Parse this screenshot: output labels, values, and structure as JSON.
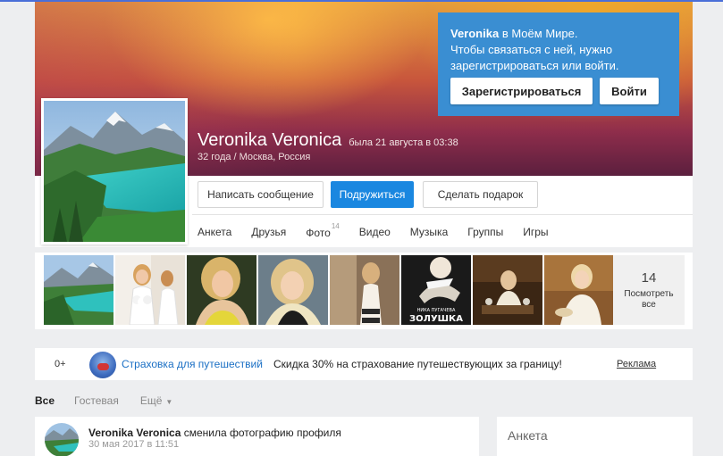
{
  "colors": {
    "accent": "#1a87e0",
    "register_box": "#3a8ed2",
    "link": "#1a6fc4"
  },
  "register": {
    "name": "Veronika",
    "line1_rest": " в Моём Мире.",
    "line2": "Чтобы связаться с ней, нужно",
    "line3": "зарегистрироваться или войти.",
    "register_label": "Зарегистрироваться",
    "login_label": "Войти"
  },
  "profile": {
    "name": "Veronika Veronica",
    "last_seen": "была 21 августа в 03:38",
    "meta": "32 года / Москва, Россия",
    "avatar_icon": "mountain-lake-photo"
  },
  "actions": {
    "message_label": "Написать сообщение",
    "friend_label": "Подружиться",
    "gift_label": "Сделать подарок"
  },
  "nav": {
    "items": [
      {
        "label": "Анкета"
      },
      {
        "label": "Друзья"
      },
      {
        "label": "Фото",
        "count": "14"
      },
      {
        "label": "Видео"
      },
      {
        "label": "Музыка"
      },
      {
        "label": "Группы"
      },
      {
        "label": "Игры"
      }
    ]
  },
  "photos": {
    "count": "14",
    "see_all_line1": "Посмотреть",
    "see_all_line2": "все",
    "poster_line1": "НИКА ПУГАЧЕВА",
    "poster_line2": "ЗОЛУШКА"
  },
  "ad": {
    "score": "0+",
    "title": "Страховка для путешествий",
    "description": "Скидка 30% на страхование путешествующих за границу!",
    "link": "Реклама"
  },
  "feed": {
    "tabs": [
      {
        "label": "Все"
      },
      {
        "label": "Гостевая"
      },
      {
        "label": "Ещё"
      }
    ]
  },
  "post": {
    "author": "Veronika Veronica",
    "action": " сменила фотографию профиля",
    "date": "30 мая 2017 в 11:51"
  },
  "side": {
    "title": "Анкета"
  }
}
